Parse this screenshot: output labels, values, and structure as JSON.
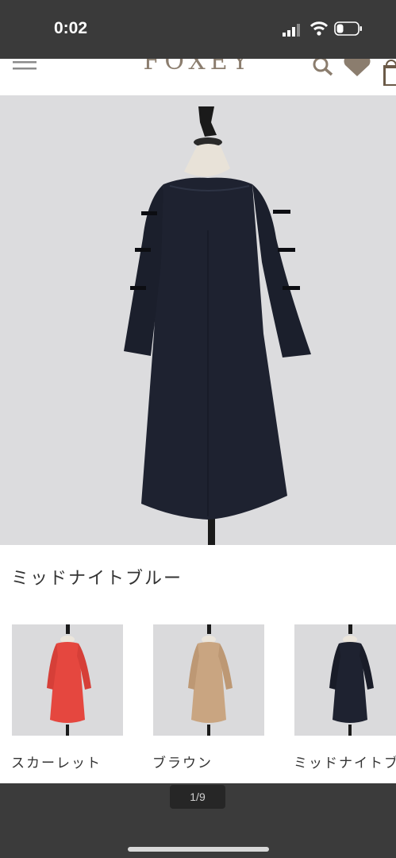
{
  "status_bar": {
    "time": "0:02"
  },
  "header": {
    "logo": "FOXEY",
    "icons": [
      "menu-icon",
      "search-icon",
      "heart-icon",
      "bag-icon"
    ]
  },
  "product": {
    "selected_color": "ミッドナイトブルー",
    "hero_dress_color": "#1e2230"
  },
  "swatches": [
    {
      "label": "スカーレット",
      "color": "#e5473f"
    },
    {
      "label": "ブラウン",
      "color": "#c9a581"
    },
    {
      "label": "ミッドナイトブ",
      "color": "#1e2230"
    }
  ],
  "viewer": {
    "page_indicator": "1/9"
  }
}
